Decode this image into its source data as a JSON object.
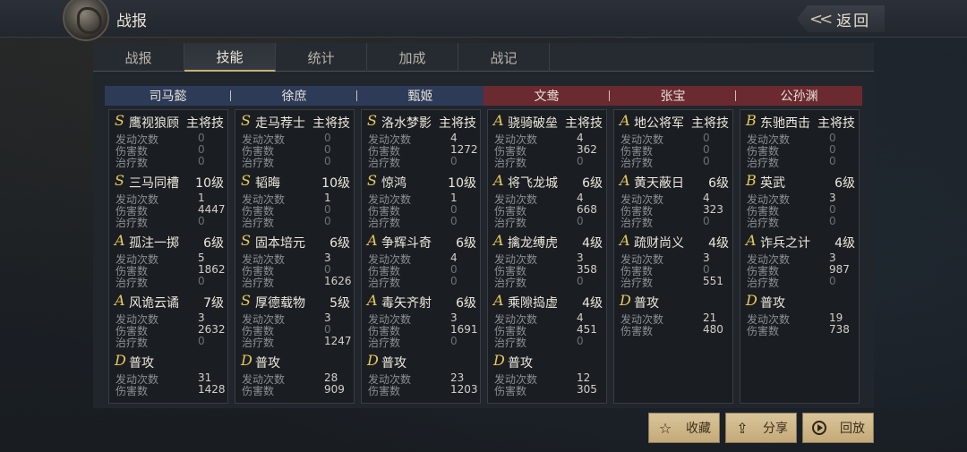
{
  "header": {
    "title": "战报",
    "back_label": "返回"
  },
  "tabs": [
    {
      "label": "战报",
      "active": false
    },
    {
      "label": "技能",
      "active": true
    },
    {
      "label": "统计",
      "active": false
    },
    {
      "label": "加成",
      "active": false
    },
    {
      "label": "战记",
      "active": false
    }
  ],
  "stat_labels": {
    "trigger": "发动次数",
    "damage": "伤害数",
    "heal": "治疗数"
  },
  "columns": [
    {
      "name": "司马懿",
      "side": "blue",
      "skills": [
        {
          "grade": "S",
          "name": "鹰视狼顾",
          "level": "主将技",
          "trigger": "0",
          "damage": "0",
          "heal": "0"
        },
        {
          "grade": "S",
          "name": "三马同槽",
          "level": "10级",
          "trigger": "1",
          "damage": "4447",
          "heal": "0"
        },
        {
          "grade": "A",
          "name": "孤注一掷",
          "level": "6级",
          "trigger": "5",
          "damage": "1862",
          "heal": "0"
        },
        {
          "grade": "A",
          "name": "风诡云谲",
          "level": "7级",
          "trigger": "3",
          "damage": "2632",
          "heal": "0"
        },
        {
          "grade": "D",
          "name": "普攻",
          "level": "",
          "trigger": "31",
          "damage": "1428",
          "heal": null
        }
      ]
    },
    {
      "name": "徐庶",
      "side": "blue",
      "skills": [
        {
          "grade": "S",
          "name": "走马荐士",
          "level": "主将技",
          "trigger": "0",
          "damage": "0",
          "heal": "0"
        },
        {
          "grade": "S",
          "name": "韬晦",
          "level": "10级",
          "trigger": "1",
          "damage": "0",
          "heal": "0"
        },
        {
          "grade": "S",
          "name": "固本培元",
          "level": "6级",
          "trigger": "3",
          "damage": "0",
          "heal": "1626"
        },
        {
          "grade": "S",
          "name": "厚德载物",
          "level": "5级",
          "trigger": "3",
          "damage": "0",
          "heal": "1247"
        },
        {
          "grade": "D",
          "name": "普攻",
          "level": "",
          "trigger": "28",
          "damage": "909",
          "heal": null
        }
      ]
    },
    {
      "name": "甄姬",
      "side": "blue",
      "skills": [
        {
          "grade": "S",
          "name": "洛水梦影",
          "level": "主将技",
          "trigger": "4",
          "damage": "1272",
          "heal": "0"
        },
        {
          "grade": "S",
          "name": "惊鸿",
          "level": "10级",
          "trigger": "1",
          "damage": "0",
          "heal": "0"
        },
        {
          "grade": "A",
          "name": "争辉斗奇",
          "level": "6级",
          "trigger": "4",
          "damage": "0",
          "heal": "0"
        },
        {
          "grade": "A",
          "name": "毒矢齐射",
          "level": "6级",
          "trigger": "3",
          "damage": "1691",
          "heal": "0"
        },
        {
          "grade": "D",
          "name": "普攻",
          "level": "",
          "trigger": "23",
          "damage": "1203",
          "heal": null
        }
      ]
    },
    {
      "name": "文鸯",
      "side": "red",
      "skills": [
        {
          "grade": "A",
          "name": "骁骑破垒",
          "level": "主将技",
          "trigger": "4",
          "damage": "362",
          "heal": "0"
        },
        {
          "grade": "A",
          "name": "将飞龙城",
          "level": "6级",
          "trigger": "4",
          "damage": "668",
          "heal": "0"
        },
        {
          "grade": "A",
          "name": "擒龙缚虎",
          "level": "4级",
          "trigger": "3",
          "damage": "358",
          "heal": "0"
        },
        {
          "grade": "A",
          "name": "乘隙捣虚",
          "level": "4级",
          "trigger": "4",
          "damage": "451",
          "heal": "0"
        },
        {
          "grade": "D",
          "name": "普攻",
          "level": "",
          "trigger": "12",
          "damage": "305",
          "heal": null
        }
      ]
    },
    {
      "name": "张宝",
      "side": "red",
      "skills": [
        {
          "grade": "A",
          "name": "地公将军",
          "level": "主将技",
          "trigger": "0",
          "damage": "0",
          "heal": "0"
        },
        {
          "grade": "A",
          "name": "黄天蔽日",
          "level": "6级",
          "trigger": "4",
          "damage": "323",
          "heal": "0"
        },
        {
          "grade": "A",
          "name": "疏财尚义",
          "level": "4级",
          "trigger": "3",
          "damage": "0",
          "heal": "551"
        },
        {
          "grade": "D",
          "name": "普攻",
          "level": "",
          "trigger": "21",
          "damage": "480",
          "heal": null
        }
      ]
    },
    {
      "name": "公孙渊",
      "side": "red",
      "skills": [
        {
          "grade": "B",
          "name": "东驰西击",
          "level": "主将技",
          "trigger": "0",
          "damage": "0",
          "heal": "0"
        },
        {
          "grade": "B",
          "name": "英武",
          "level": "6级",
          "trigger": "3",
          "damage": "0",
          "heal": "0"
        },
        {
          "grade": "A",
          "name": "诈兵之计",
          "level": "4级",
          "trigger": "3",
          "damage": "987",
          "heal": "0"
        },
        {
          "grade": "D",
          "name": "普攻",
          "level": "",
          "trigger": "19",
          "damage": "738",
          "heal": null
        }
      ]
    }
  ],
  "buttons": [
    {
      "label": "收藏",
      "icon": "star-icon"
    },
    {
      "label": "分享",
      "icon": "share-icon"
    },
    {
      "label": "回放",
      "icon": "play-icon"
    }
  ],
  "colors": {
    "grade": "#e8c85a",
    "blue_header": "#2d3b58",
    "red_header": "#6b2a30",
    "button": "#d9c49a"
  }
}
